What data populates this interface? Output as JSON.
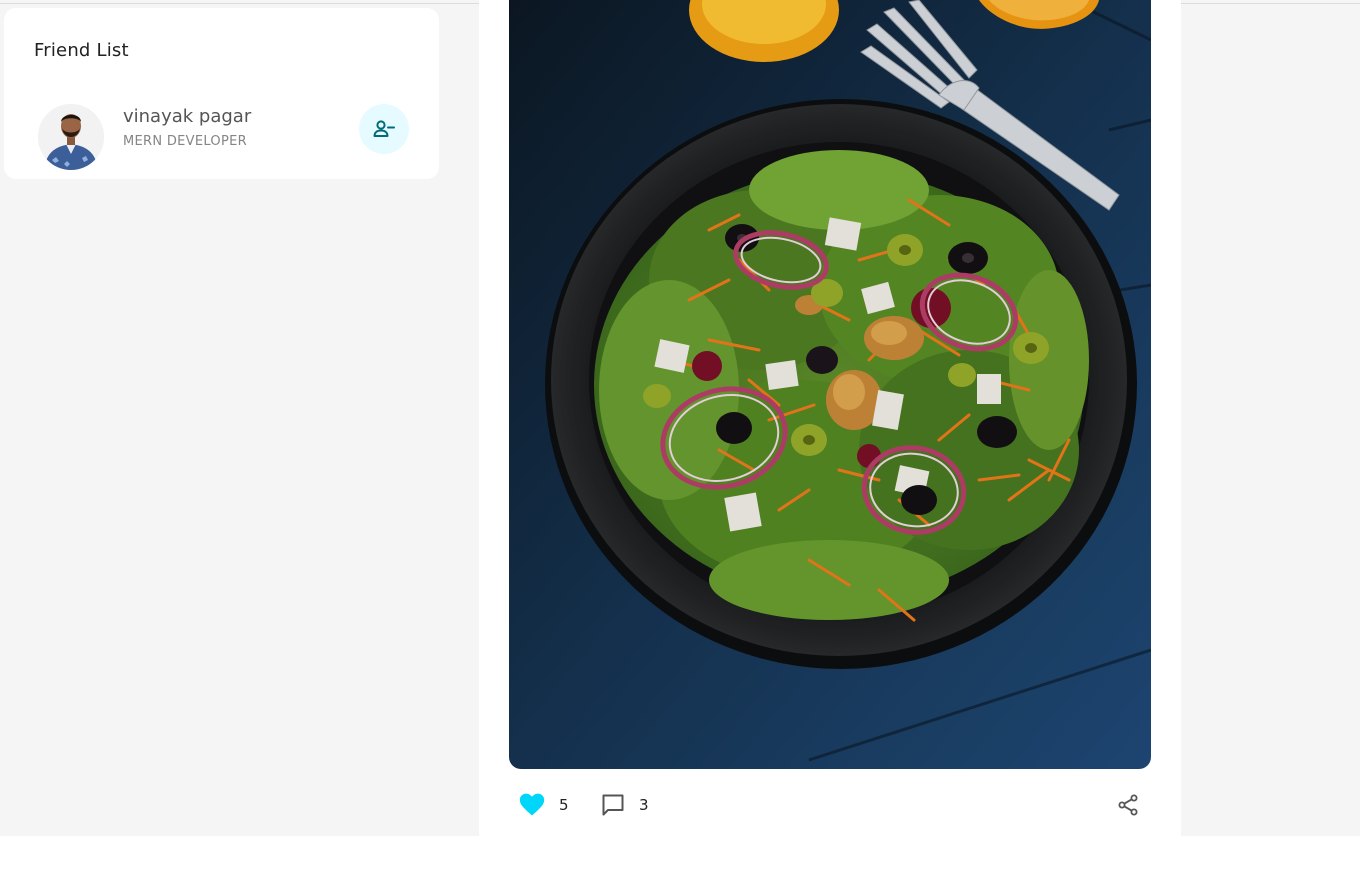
{
  "friend_list": {
    "title": "Friend List",
    "friends": [
      {
        "name": "vinayak pagar",
        "occupation": "MERN DEVELOPER",
        "action_icon": "remove-friend-icon"
      }
    ]
  },
  "post": {
    "image_icon": "salad-photo",
    "likes": "5",
    "comments": "3",
    "liked": true,
    "like_icon": "heart-icon",
    "comment_icon": "chat-bubble-icon",
    "share_icon": "share-icon"
  },
  "colors": {
    "accent": "#00d5fa",
    "accent_dark": "#006b7d",
    "accent_light": "#e6fbff",
    "background": "#f5f5f5",
    "card": "#ffffff"
  }
}
